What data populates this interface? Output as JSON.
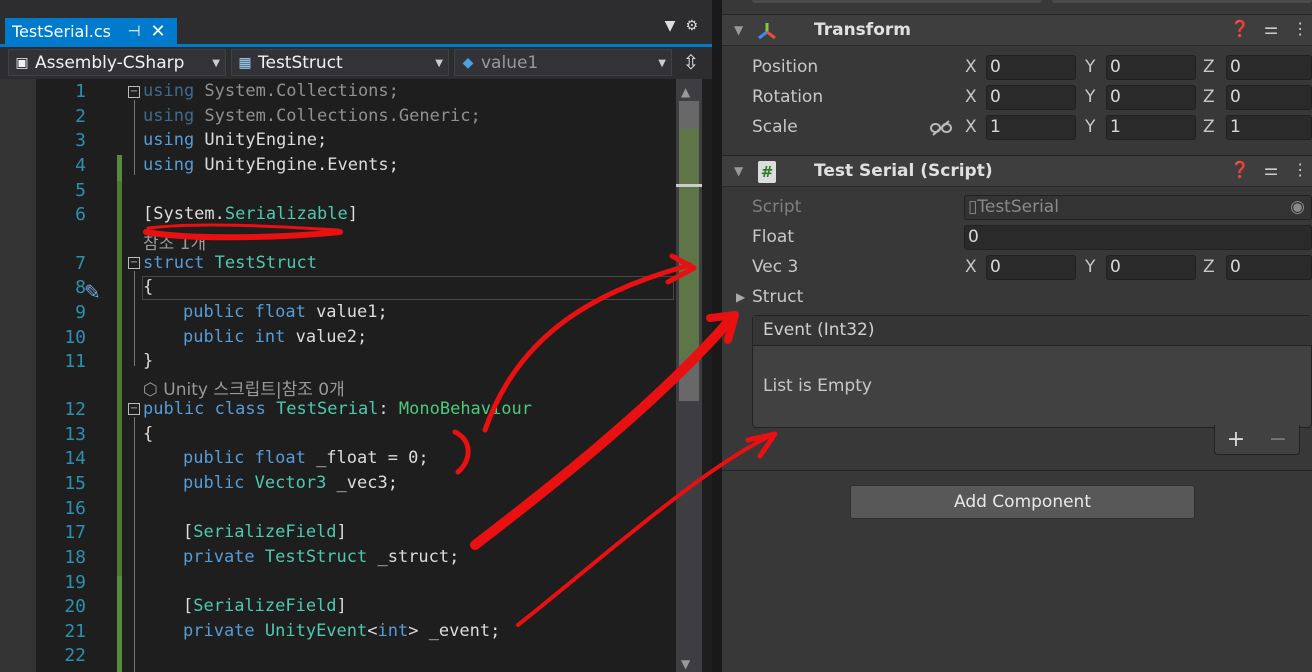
{
  "editor": {
    "tab_title": "TestSerial.cs",
    "tab_pin": "⊣",
    "tab_close": "✕",
    "nav": {
      "project": "Assembly-CSharp",
      "type": "TestStruct",
      "member": "value1"
    },
    "line_numbers": [
      "1",
      "2",
      "3",
      "4",
      "5",
      "6",
      "7",
      "8",
      "9",
      "10",
      "11",
      "12",
      "13",
      "14",
      "15",
      "16",
      "17",
      "18",
      "19",
      "20",
      "21",
      "22"
    ],
    "annotations": {
      "refs_struct": "참조 1개",
      "refs_class": "Unity 스크립트|참조 0개"
    },
    "code": {
      "l1a": "using",
      "l1b": " System.Collections;",
      "l2a": "using",
      "l2b": " System.Collections.Generic;",
      "l3a": "using",
      "l3b": " UnityEngine;",
      "l4a": "using",
      "l4b": " UnityEngine.Events;",
      "l6a": "[System.",
      "l6b": "Serializable",
      "l6c": "]",
      "l7a": "struct",
      "l7b": " TestStruct",
      "l8": "{",
      "l9a": "public float",
      "l9b": " value1;",
      "l10a": "public int",
      "l10b": " value2;",
      "l11": "}",
      "l12a": "public class",
      "l12b": " TestSerial",
      "l12c": ": ",
      "l12d": "MonoBehaviour",
      "l13": "{",
      "l14a": "public float",
      "l14b": " _float = 0;",
      "l15a": "public",
      "l15b": " Vector3",
      "l15c": " _vec3;",
      "l17a": "[",
      "l17b": "SerializeField",
      "l17c": "]",
      "l18a": "private",
      "l18b": " TestStruct",
      "l18c": " _struct;",
      "l20a": "[",
      "l20b": "SerializeField",
      "l20c": "]",
      "l21a": "private",
      "l21b": " UnityEvent",
      "l21c": "<",
      "l21d": "int",
      "l21e": "> _event;"
    }
  },
  "inspector": {
    "transform": {
      "title": "Transform",
      "position_label": "Position",
      "rotation_label": "Rotation",
      "scale_label": "Scale",
      "axis_x": "X",
      "axis_y": "Y",
      "axis_z": "Z",
      "position": [
        "0",
        "0",
        "0"
      ],
      "rotation": [
        "0",
        "0",
        "0"
      ],
      "scale": [
        "1",
        "1",
        "1"
      ]
    },
    "script_component": {
      "title": "Test Serial (Script)",
      "script_label": "Script",
      "script_value": "TestSerial",
      "float_label": "Float",
      "float_value": "0",
      "vec3_label": "Vec 3",
      "vec3": [
        "0",
        "0",
        "0"
      ],
      "struct_label": "Struct",
      "event_title": "Event (Int32)",
      "event_empty": "List is Empty",
      "plus": "+",
      "minus": "−"
    },
    "add_component": "Add Component"
  },
  "colors": {
    "vs_accent": "#007acc",
    "annotation_red": "#e81010"
  }
}
